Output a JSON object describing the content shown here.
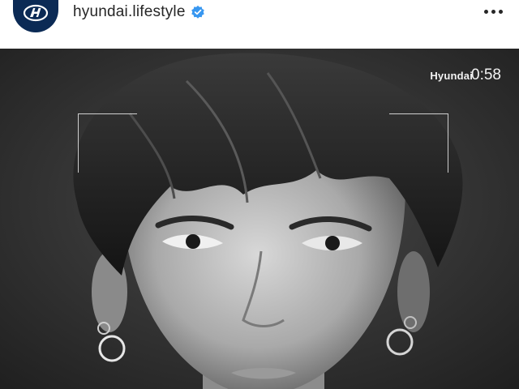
{
  "post_header": {
    "username": "hyundai.lifestyle",
    "verified": true,
    "avatar_icon": "hyundai-logo-icon",
    "more_icon": "more-options-icon"
  },
  "media": {
    "type": "video",
    "subject": "black-and-white portrait",
    "watermark_brand": "Hyundai",
    "timestamp": "0:58"
  },
  "colors": {
    "avatar_bg": "#0b2a55",
    "verified_badge": "#3897f0",
    "text": "#262626"
  }
}
